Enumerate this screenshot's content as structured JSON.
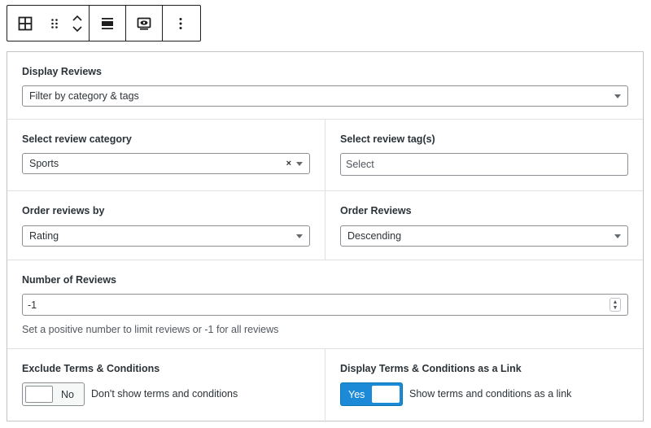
{
  "toolbar": {
    "buttons": [
      {
        "icon": "table-grid-icon"
      },
      {
        "icon": "drag-handle-icon"
      },
      {
        "icon": "move-up-down-icon"
      },
      {
        "icon": "align-icon"
      },
      {
        "icon": "preview-icon"
      },
      {
        "icon": "more-options-icon"
      }
    ]
  },
  "display_reviews": {
    "label": "Display Reviews",
    "value": "Filter by category & tags"
  },
  "review_category": {
    "label": "Select review category",
    "value": "Sports",
    "clear": "×"
  },
  "review_tags": {
    "label": "Select review tag(s)",
    "placeholder": "Select"
  },
  "order_by": {
    "label": "Order reviews by",
    "value": "Rating"
  },
  "order_direction": {
    "label": "Order Reviews",
    "value": "Descending"
  },
  "number_of_reviews": {
    "label": "Number of Reviews",
    "value": "-1",
    "help": "Set a positive number to limit reviews or -1 for all reviews"
  },
  "exclude_terms": {
    "label": "Exclude Terms & Conditions",
    "toggle_text": "No",
    "checked": false,
    "description": "Don't show terms and conditions"
  },
  "terms_link": {
    "label": "Display Terms & Conditions as a Link",
    "toggle_text": "Yes",
    "checked": true,
    "description": "Show terms and conditions as a link"
  },
  "colors": {
    "toggle_on": "#1c8ad6",
    "border": "#8c8f94"
  }
}
